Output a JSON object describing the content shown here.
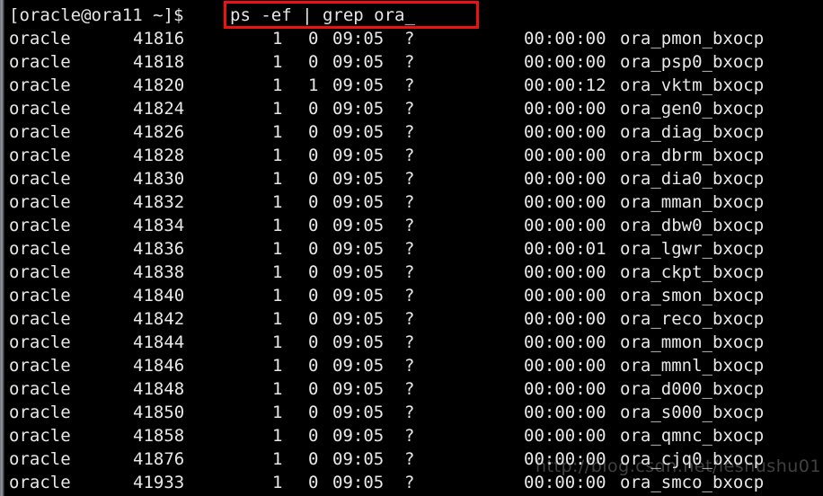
{
  "terminal": {
    "background_color": "#000000",
    "foreground_color": "#e8e8e8",
    "highlight_color": "#ee1111",
    "prompt": "[oracle@ora11 ~]$",
    "command": "ps -ef | grep ora_",
    "watermark": "http://blog.csdn.net/leshushu01"
  },
  "processes": [
    {
      "user": "oracle",
      "pid": "41816",
      "ppid": "1",
      "cpu": "0",
      "stime": "09:05",
      "tty": "?",
      "time": "00:00:00",
      "cmd": "ora_pmon_bxocp"
    },
    {
      "user": "oracle",
      "pid": "41818",
      "ppid": "1",
      "cpu": "0",
      "stime": "09:05",
      "tty": "?",
      "time": "00:00:00",
      "cmd": "ora_psp0_bxocp"
    },
    {
      "user": "oracle",
      "pid": "41820",
      "ppid": "1",
      "cpu": "1",
      "stime": "09:05",
      "tty": "?",
      "time": "00:00:12",
      "cmd": "ora_vktm_bxocp"
    },
    {
      "user": "oracle",
      "pid": "41824",
      "ppid": "1",
      "cpu": "0",
      "stime": "09:05",
      "tty": "?",
      "time": "00:00:00",
      "cmd": "ora_gen0_bxocp"
    },
    {
      "user": "oracle",
      "pid": "41826",
      "ppid": "1",
      "cpu": "0",
      "stime": "09:05",
      "tty": "?",
      "time": "00:00:00",
      "cmd": "ora_diag_bxocp"
    },
    {
      "user": "oracle",
      "pid": "41828",
      "ppid": "1",
      "cpu": "0",
      "stime": "09:05",
      "tty": "?",
      "time": "00:00:00",
      "cmd": "ora_dbrm_bxocp"
    },
    {
      "user": "oracle",
      "pid": "41830",
      "ppid": "1",
      "cpu": "0",
      "stime": "09:05",
      "tty": "?",
      "time": "00:00:00",
      "cmd": "ora_dia0_bxocp"
    },
    {
      "user": "oracle",
      "pid": "41832",
      "ppid": "1",
      "cpu": "0",
      "stime": "09:05",
      "tty": "?",
      "time": "00:00:00",
      "cmd": "ora_mman_bxocp"
    },
    {
      "user": "oracle",
      "pid": "41834",
      "ppid": "1",
      "cpu": "0",
      "stime": "09:05",
      "tty": "?",
      "time": "00:00:00",
      "cmd": "ora_dbw0_bxocp"
    },
    {
      "user": "oracle",
      "pid": "41836",
      "ppid": "1",
      "cpu": "0",
      "stime": "09:05",
      "tty": "?",
      "time": "00:00:01",
      "cmd": "ora_lgwr_bxocp"
    },
    {
      "user": "oracle",
      "pid": "41838",
      "ppid": "1",
      "cpu": "0",
      "stime": "09:05",
      "tty": "?",
      "time": "00:00:00",
      "cmd": "ora_ckpt_bxocp"
    },
    {
      "user": "oracle",
      "pid": "41840",
      "ppid": "1",
      "cpu": "0",
      "stime": "09:05",
      "tty": "?",
      "time": "00:00:00",
      "cmd": "ora_smon_bxocp"
    },
    {
      "user": "oracle",
      "pid": "41842",
      "ppid": "1",
      "cpu": "0",
      "stime": "09:05",
      "tty": "?",
      "time": "00:00:00",
      "cmd": "ora_reco_bxocp"
    },
    {
      "user": "oracle",
      "pid": "41844",
      "ppid": "1",
      "cpu": "0",
      "stime": "09:05",
      "tty": "?",
      "time": "00:00:00",
      "cmd": "ora_mmon_bxocp"
    },
    {
      "user": "oracle",
      "pid": "41846",
      "ppid": "1",
      "cpu": "0",
      "stime": "09:05",
      "tty": "?",
      "time": "00:00:00",
      "cmd": "ora_mmnl_bxocp"
    },
    {
      "user": "oracle",
      "pid": "41848",
      "ppid": "1",
      "cpu": "0",
      "stime": "09:05",
      "tty": "?",
      "time": "00:00:00",
      "cmd": "ora_d000_bxocp"
    },
    {
      "user": "oracle",
      "pid": "41850",
      "ppid": "1",
      "cpu": "0",
      "stime": "09:05",
      "tty": "?",
      "time": "00:00:00",
      "cmd": "ora_s000_bxocp"
    },
    {
      "user": "oracle",
      "pid": "41858",
      "ppid": "1",
      "cpu": "0",
      "stime": "09:05",
      "tty": "?",
      "time": "00:00:00",
      "cmd": "ora_qmnc_bxocp"
    },
    {
      "user": "oracle",
      "pid": "41876",
      "ppid": "1",
      "cpu": "0",
      "stime": "09:05",
      "tty": "?",
      "time": "00:00:00",
      "cmd": "ora_cjq0_bxocp"
    },
    {
      "user": "oracle",
      "pid": "41933",
      "ppid": "1",
      "cpu": "0",
      "stime": "09:05",
      "tty": "?",
      "time": "00:00:00",
      "cmd": "ora_smco_bxocp"
    }
  ]
}
